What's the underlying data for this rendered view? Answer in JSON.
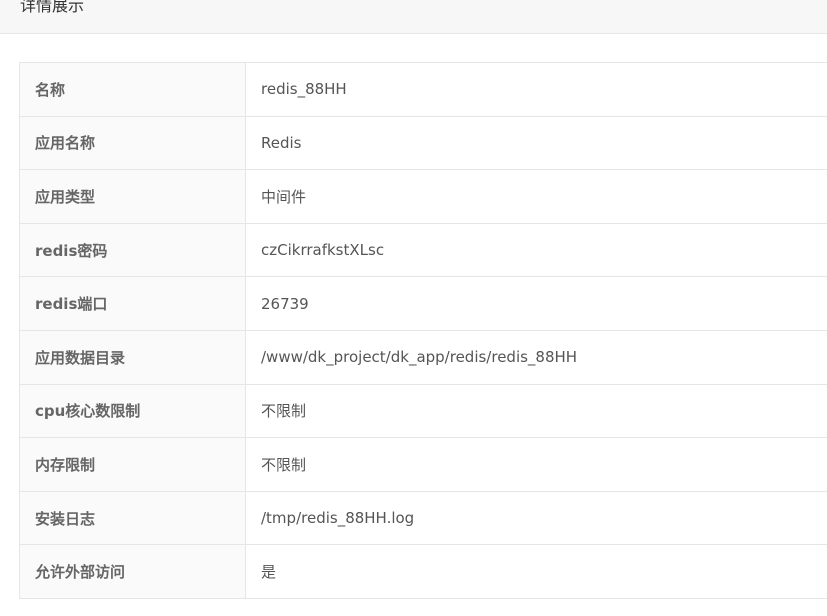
{
  "header": {
    "title": "详情展示"
  },
  "details": [
    {
      "label": "名称",
      "value": "redis_88HH"
    },
    {
      "label": "应用名称",
      "value": "Redis"
    },
    {
      "label": "应用类型",
      "value": "中间件"
    },
    {
      "label": "redis密码",
      "value": "czCikrrafkstXLsc"
    },
    {
      "label": "redis端口",
      "value": "26739"
    },
    {
      "label": "应用数据目录",
      "value": "/www/dk_project/dk_app/redis/redis_88HH"
    },
    {
      "label": "cpu核心数限制",
      "value": "不限制"
    },
    {
      "label": "内存限制",
      "value": "不限制"
    },
    {
      "label": "安装日志",
      "value": "/tmp/redis_88HH.log"
    },
    {
      "label": "允许外部访问",
      "value": "是"
    }
  ]
}
